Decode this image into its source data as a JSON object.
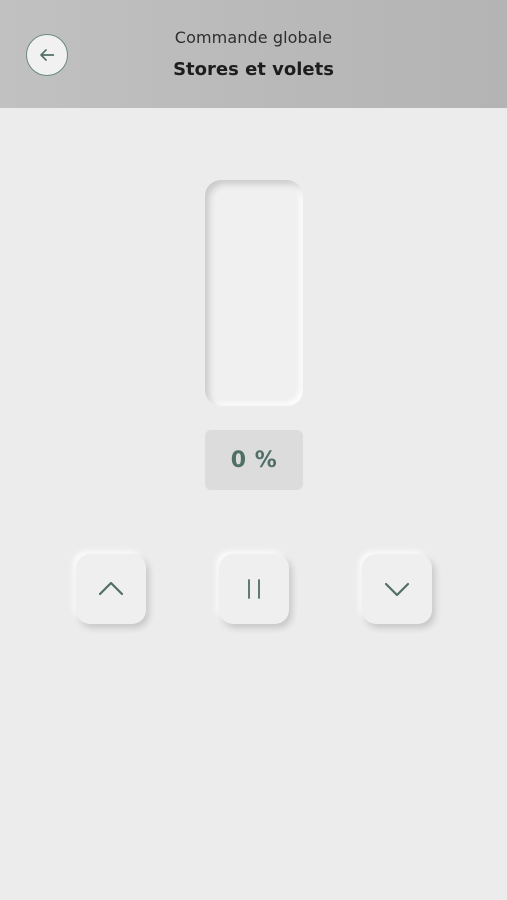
{
  "header": {
    "subtitle": "Commande globale",
    "title": "Stores et volets",
    "back_icon": "arrow-left-icon"
  },
  "slider": {
    "level_percent": 0,
    "value_text": "0 %"
  },
  "controls": {
    "up_icon": "chevron-up-icon",
    "stop_icon": "pause-icon",
    "down_icon": "chevron-down-icon"
  },
  "colors": {
    "accent": "#4f6f67",
    "background": "#ececec",
    "header": "#bcbcbc"
  }
}
